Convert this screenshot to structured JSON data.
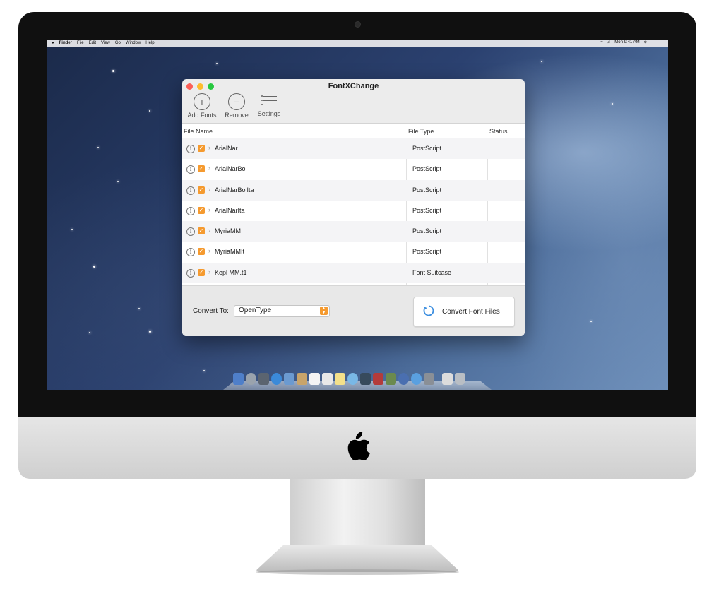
{
  "menubar": {
    "items": [
      "Finder",
      "File",
      "Edit",
      "View",
      "Go",
      "Window",
      "Help"
    ],
    "clock": "Mon 9:41 AM"
  },
  "window": {
    "title": "FontXChange",
    "toolbar": {
      "add_label": "Add Fonts",
      "remove_label": "Remove",
      "settings_label": "Settings"
    },
    "table": {
      "columns": [
        "File Name",
        "File Type",
        "Status"
      ],
      "rows": [
        {
          "name": "ArialNar",
          "type": "PostScript",
          "status": ""
        },
        {
          "name": "ArialNarBol",
          "type": "PostScript",
          "status": ""
        },
        {
          "name": "ArialNarBolIta",
          "type": "PostScript",
          "status": ""
        },
        {
          "name": "ArialNarIta",
          "type": "PostScript",
          "status": ""
        },
        {
          "name": "MyriaMM",
          "type": "PostScript",
          "status": ""
        },
        {
          "name": "MyriaMMIt",
          "type": "PostScript",
          "status": ""
        },
        {
          "name": "Kepl MM.t1",
          "type": "Font Suitcase",
          "status": ""
        }
      ]
    },
    "footer": {
      "convert_to_label": "Convert To:",
      "convert_to_value": "OpenType",
      "convert_button_label": "Convert Font Files"
    }
  },
  "colors": {
    "accent": "#f59a2f",
    "close": "#fc5f57",
    "minimize": "#fdbc2e",
    "maximize": "#28c840",
    "refresh": "#3d8fe0"
  }
}
